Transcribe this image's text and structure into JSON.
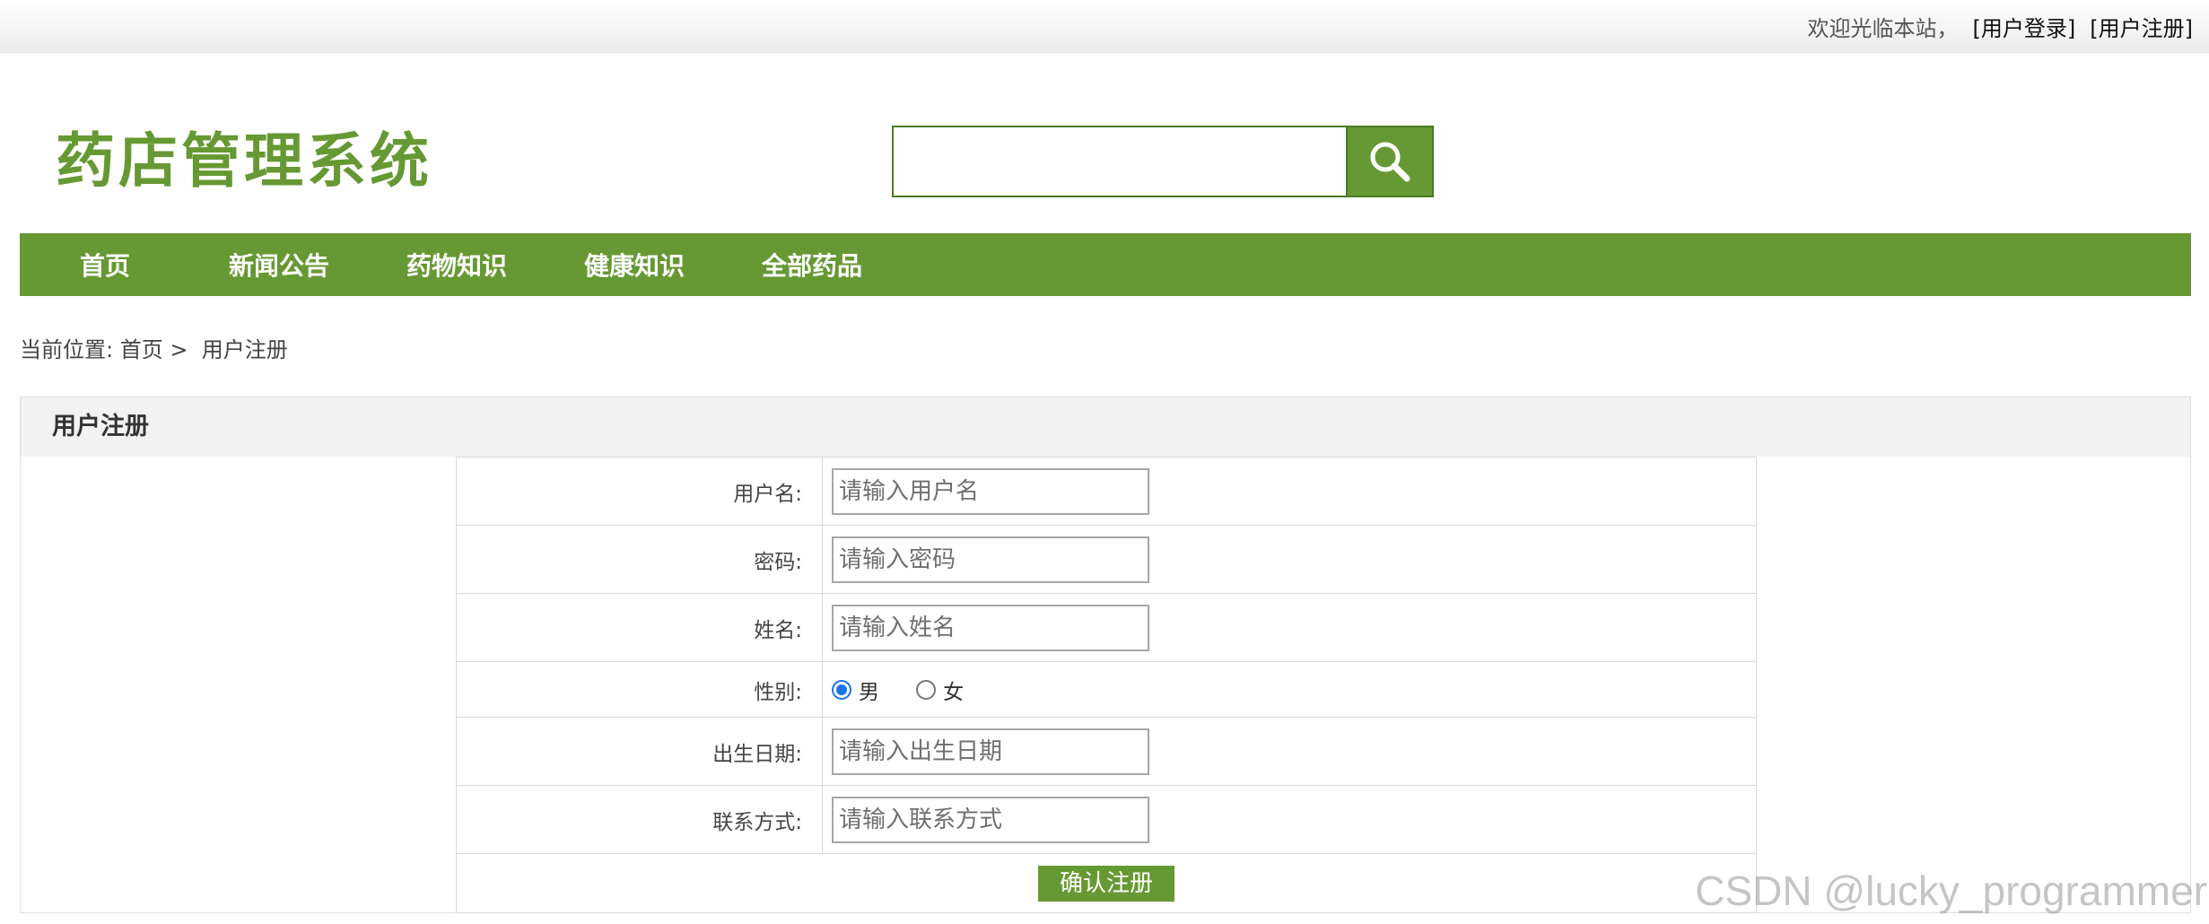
{
  "topbar": {
    "welcome": "欢迎光临本站，",
    "login_link": "[用户登录]",
    "register_link": "[用户注册]"
  },
  "header": {
    "logo": "药店管理系统",
    "search_placeholder": "",
    "search_icon": "search-icon"
  },
  "nav": {
    "items": [
      {
        "label": "首页"
      },
      {
        "label": "新闻公告"
      },
      {
        "label": "药物知识"
      },
      {
        "label": "健康知识"
      },
      {
        "label": "全部药品"
      }
    ]
  },
  "breadcrumb": {
    "prefix": "当前位置: ",
    "home": "首页",
    "separator": " >  ",
    "current": "用户注册"
  },
  "form": {
    "title": "用户注册",
    "fields": [
      {
        "label": "用户名:",
        "placeholder": "请输入用户名",
        "value": ""
      },
      {
        "label": "密码:",
        "placeholder": "请输入密码",
        "value": ""
      },
      {
        "label": "姓名:",
        "placeholder": "请输入姓名",
        "value": ""
      },
      {
        "label": "出生日期:",
        "placeholder": "请输入出生日期",
        "value": ""
      },
      {
        "label": "联系方式:",
        "placeholder": "请输入联系方式",
        "value": ""
      }
    ],
    "gender": {
      "label": "性别:",
      "options": [
        {
          "label": "男",
          "selected": true
        },
        {
          "label": "女",
          "selected": false
        }
      ]
    },
    "submit_label": "确认注册"
  },
  "watermark": "CSDN @lucky_programmer",
  "colors": {
    "brand_green": "#669933",
    "radio_selected": "#1a73e8"
  }
}
